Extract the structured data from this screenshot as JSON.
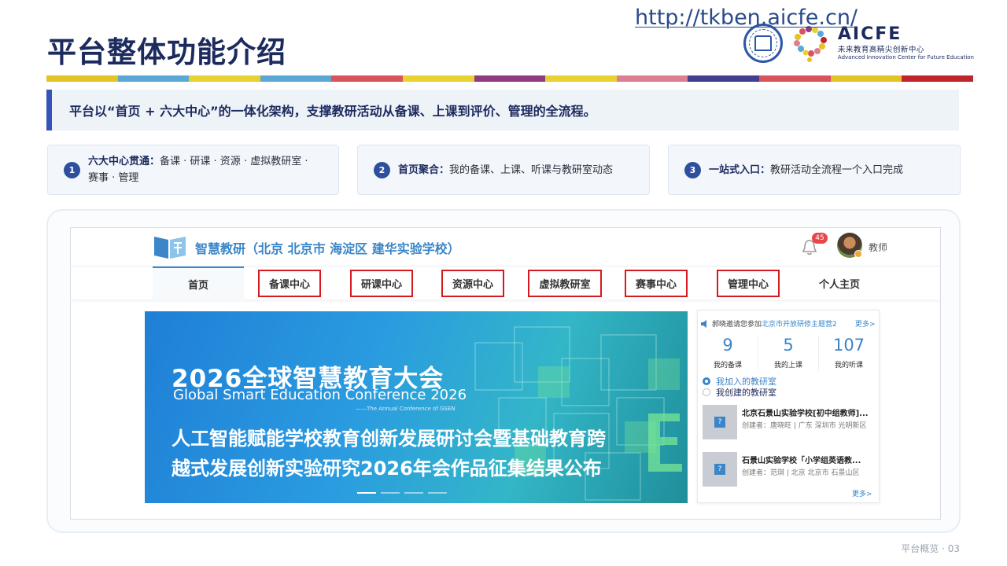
{
  "slide": {
    "title": "平台整体功能介绍",
    "footer": "平台概览 · 03",
    "strip_colors": [
      "#e3c424",
      "#5ba8d6",
      "#e7d232",
      "#5ba8d6",
      "#d9535c",
      "#e7d232",
      "#8e3b84",
      "#e7d232",
      "#dd7f90",
      "#423f8e",
      "#d9535c",
      "#e3c424",
      "#c0252b"
    ]
  },
  "logo": {
    "name": "AICFE",
    "cn": "未来教育高精尖创新中心",
    "en": "Advanced Innovation Center for Future Education"
  },
  "banner": {
    "text": "平台以“首页 + 六大中心”的一体化架构，支撑教研活动从备课、上课到评价、管理的全流程。",
    "url": "http://tkben.aicfe.cn/"
  },
  "features": [
    {
      "num": "1",
      "title": "六大中心贯通：",
      "desc": "备课 · 研课 · 资源 · 虚拟教研室 · 赛事 · 管理"
    },
    {
      "num": "2",
      "title": "首页聚合：",
      "desc": "我的备课、上课、听课与教研室动态"
    },
    {
      "num": "3",
      "title": "一站式入口：",
      "desc": "教研活动全流程一个入口完成"
    }
  ],
  "app": {
    "title": "智慧教研（北京 北京市 海淀区 建华实验学校）",
    "notification_count": "45",
    "user_role": "教师",
    "nav": [
      "首页",
      "备课中心",
      "研课中心",
      "资源中心",
      "虚拟教研室",
      "赛事中心",
      "管理中心",
      "个人主页"
    ],
    "hero": {
      "headline": "2026全球智慧教育大会",
      "english": "Global Smart Education Conference 2026",
      "sub": "——The Annual Conference of GSEN",
      "line1": "人工智能赋能学校教育创新发展研讨会暨基础教育跨",
      "line2": "越式发展创新实验研究2026年会作品征集结果公布"
    },
    "side": {
      "notice_prefix": "郝晓邀请您参加",
      "notice_link": "北京市开放研修主题营2",
      "notice_more": "更多>",
      "stats": [
        {
          "value": "9",
          "label": "我的备课"
        },
        {
          "value": "5",
          "label": "我的上课"
        },
        {
          "value": "107",
          "label": "我的听课"
        }
      ],
      "radio_joined": "我加入的教研室",
      "radio_created": "我创建的教研室",
      "rooms": [
        {
          "title": "北京石景山实验学校[初中组教师]...",
          "meta": "创建者：唐晓旺 | 广东 深圳市 光明新区"
        },
        {
          "title": "石景山实验学校「小学组英语教...",
          "meta": "创建者：范琪 | 北京 北京市 石景山区"
        }
      ],
      "more": "更多>"
    }
  }
}
